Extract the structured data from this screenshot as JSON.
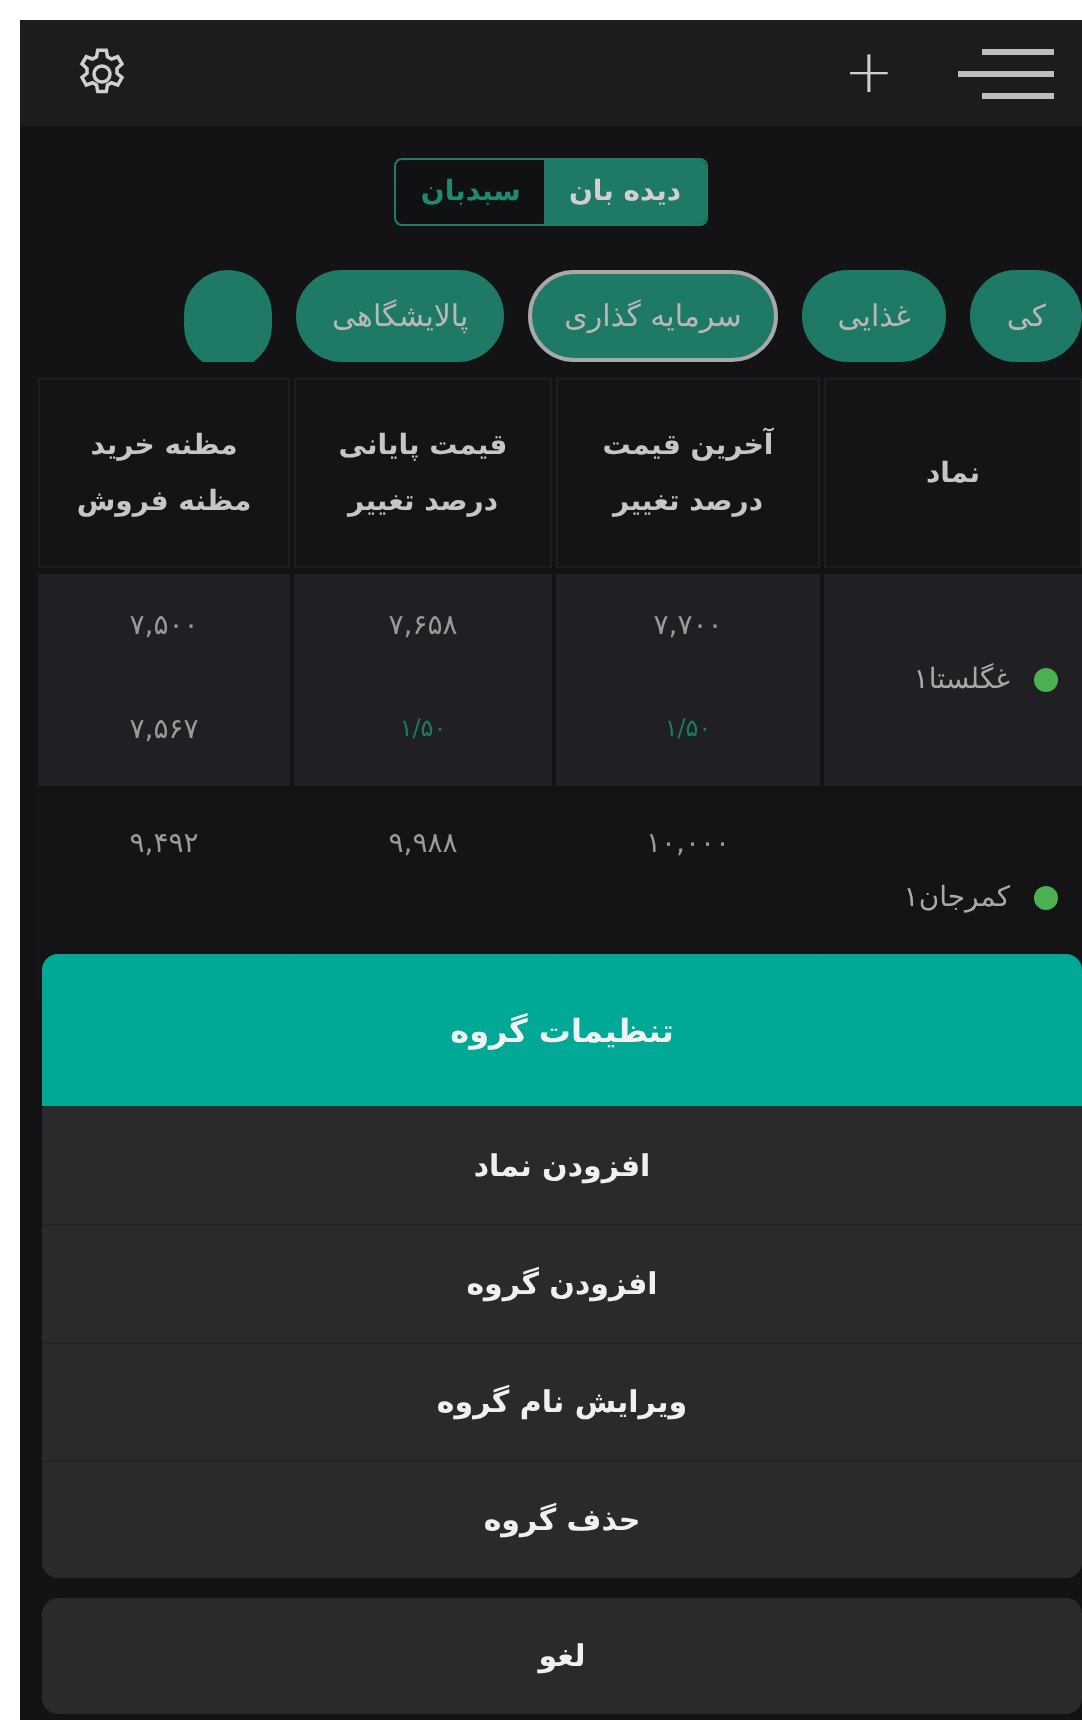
{
  "toolbar": {
    "add": "+"
  },
  "view_toggle": [
    {
      "label": "دیده بان",
      "selected": true
    },
    {
      "label": "سبدبان",
      "selected": false
    }
  ],
  "groups": [
    {
      "label": "کی",
      "selected": false
    },
    {
      "label": "غذایی",
      "selected": false
    },
    {
      "label": "سرمایه گذاری",
      "selected": true
    },
    {
      "label": "پالایشگاهی",
      "selected": false
    }
  ],
  "table": {
    "columns": [
      "نماد",
      "آخرین قیمت\nدرصد تغییر",
      "قیمت پایانی\nدرصد تغییر",
      "مظنه خرید\nمظنه فروش"
    ],
    "rows": [
      {
        "color": "#4caf50",
        "highlighted": true,
        "cells": [
          [
            "غگلستا۱"
          ],
          [
            "۷,۷۰۰",
            "۱/۵۰"
          ],
          [
            "۷,۶۵۸",
            "۱/۵۰"
          ],
          [
            "۷,۵۰۰",
            "۷,۵۶۷"
          ]
        ]
      },
      {
        "color": "#4caf50",
        "highlighted": false,
        "cells": [
          [
            "کمرجان۱"
          ],
          [
            "۱۰,۰۰۰"
          ],
          [
            "۹,۹۸۸"
          ],
          [
            "۹,۴۹۲"
          ]
        ]
      }
    ]
  },
  "sheet": {
    "title": "تنظیمات گروه",
    "items": [
      "افزودن نماد",
      "افزودن گروه",
      "ویرایش نام گروه",
      "حذف گروه"
    ],
    "cancel": "لغو"
  }
}
